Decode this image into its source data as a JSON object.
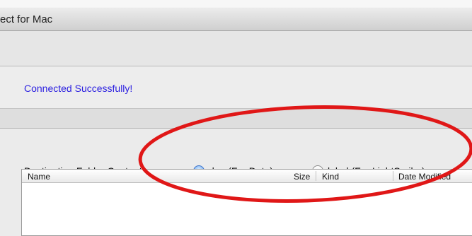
{
  "window": {
    "title": "ect for Mac"
  },
  "status": {
    "message": "Connected Successfully!",
    "color": "#2a1ee0"
  },
  "destination": {
    "label": "Destination Folder Content",
    "options": [
      {
        "label": "dup (For Data)",
        "selected": true
      },
      {
        "label": "label (For LightScribe)",
        "selected": false
      }
    ]
  },
  "table": {
    "columns": [
      "Name",
      "Size",
      "Kind",
      "Date Modified"
    ],
    "rows": []
  },
  "annotation": {
    "shape": "ellipse",
    "color": "#e01717"
  }
}
